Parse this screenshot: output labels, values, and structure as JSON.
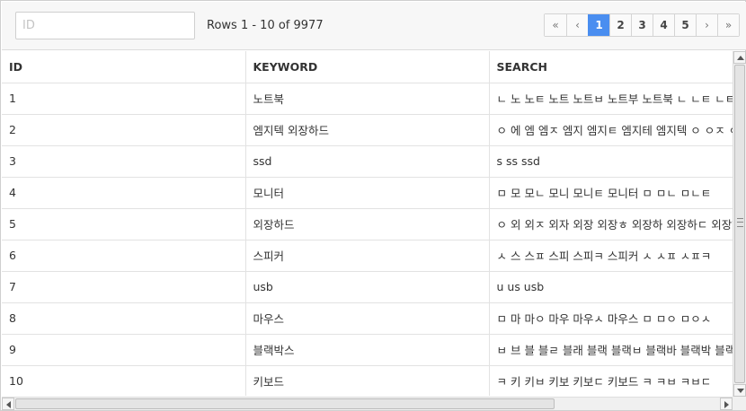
{
  "toolbar": {
    "id_placeholder": "ID",
    "id_value": "",
    "rows_info": "Rows 1 - 10 of 9977"
  },
  "pager": {
    "first": "«",
    "prev": "‹",
    "pages": [
      "1",
      "2",
      "3",
      "4",
      "5"
    ],
    "active_page": "1",
    "next": "›",
    "last": "»"
  },
  "grid": {
    "columns": [
      "ID",
      "KEYWORD",
      "SEARCH"
    ],
    "rows": [
      [
        "1",
        "노트북",
        "ㄴ 노 노ㅌ 노트 노트ㅂ 노트부 노트북 ㄴ ㄴㅌ ㄴㅌㅂ"
      ],
      [
        "2",
        "엠지텍 외장하드",
        "ㅇ 에 엠 엠ㅈ 엠지 엠지ㅌ 엠지테 엠지텍 ㅇ ㅇㅈ ㅇㅈㅌ"
      ],
      [
        "3",
        "ssd",
        "s ss ssd"
      ],
      [
        "4",
        "모니터",
        "ㅁ 모 모ㄴ 모니 모니ㅌ 모니터 ㅁ ㅁㄴ ㅁㄴㅌ"
      ],
      [
        "5",
        "외장하드",
        "ㅇ 외 외ㅈ 외자 외장 외장ㅎ 외장하 외장하ㄷ 외장하드"
      ],
      [
        "6",
        "스피커",
        "ㅅ 스 스ㅍ 스피 스피ㅋ 스피커 ㅅ ㅅㅍ ㅅㅍㅋ"
      ],
      [
        "7",
        "usb",
        "u us usb"
      ],
      [
        "8",
        "마우스",
        "ㅁ 마 마ㅇ 마우 마우ㅅ 마우스 ㅁ ㅁㅇ ㅁㅇㅅ"
      ],
      [
        "9",
        "블랙박스",
        "ㅂ 브 블 블ㄹ 블래 블랙 블랙ㅂ 블랙바 블랙박 블랙박스"
      ],
      [
        "10",
        "키보드",
        "ㅋ 키 키ㅂ 키보 키보ㄷ 키보드 ㅋ ㅋㅂ ㅋㅂㄷ"
      ]
    ]
  }
}
